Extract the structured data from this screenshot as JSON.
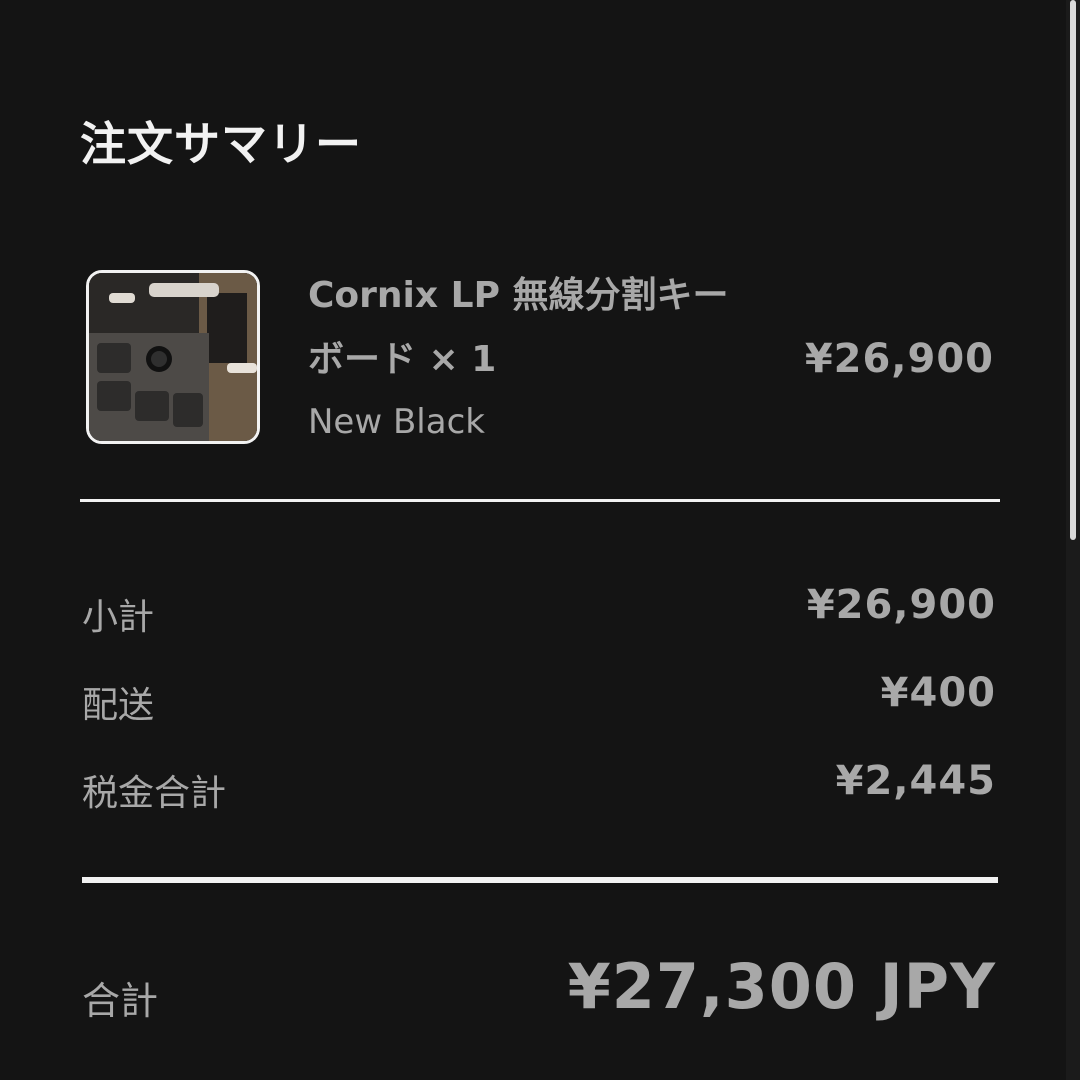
{
  "summary": {
    "title": "注文サマリー"
  },
  "item": {
    "image": "keyboard-product-thumbnail",
    "name": "Cornix LP 無線分割キーボード × 1",
    "variant": "New Black",
    "price": "¥26,900"
  },
  "rows": [
    {
      "label": "小計",
      "value": "¥26,900"
    },
    {
      "label": "配送",
      "value": "¥400"
    },
    {
      "label": "税金合計",
      "value": "¥2,445"
    }
  ],
  "total": {
    "label": "合計",
    "value": "¥27,300 JPY"
  },
  "colors": {
    "background": "#141414",
    "text_primary": "#f2f2f2",
    "text_secondary": "#a8a8a8",
    "divider": "#f2f2f2"
  }
}
